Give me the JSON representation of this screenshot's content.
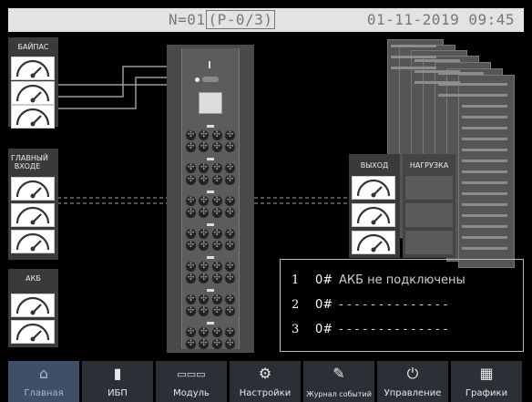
{
  "status": {
    "system_id": "N=01",
    "phase_id": "(P-0/3)",
    "datetime": "01-11-2019 09:45"
  },
  "panels": {
    "bypass": {
      "title": "БАЙПАС"
    },
    "main_input": {
      "title": "ГЛАВНЫЙ ВХОДЕ"
    },
    "battery": {
      "title": "АКБ"
    },
    "output": {
      "title": "ВЫХОД"
    },
    "load": {
      "title": "НАГРУЗКА"
    }
  },
  "messages": [
    {
      "num": "1",
      "code": "0#",
      "text": "АКБ не подключены"
    },
    {
      "num": "2",
      "code": "0#",
      "text": "- - - - - - - - - - - - - -"
    },
    {
      "num": "3",
      "code": "0#",
      "text": "- - - - - - - - - - - - - -"
    }
  ],
  "nav": [
    {
      "label": "Главная",
      "icon": "home-icon",
      "glyph": "⌂"
    },
    {
      "label": "ИБП",
      "icon": "ups-icon",
      "glyph": "▮"
    },
    {
      "label": "Модуль",
      "icon": "module-icon",
      "glyph": "▭▭▭"
    },
    {
      "label": "Настройки",
      "icon": "gear-icon",
      "glyph": "⚙"
    },
    {
      "label": "Журнал событий",
      "icon": "event-log-icon",
      "glyph": "✎"
    },
    {
      "label": "Управление",
      "icon": "power-icon",
      "glyph": "⏻"
    },
    {
      "label": "Графики",
      "icon": "chart-icon",
      "glyph": "▦"
    }
  ]
}
